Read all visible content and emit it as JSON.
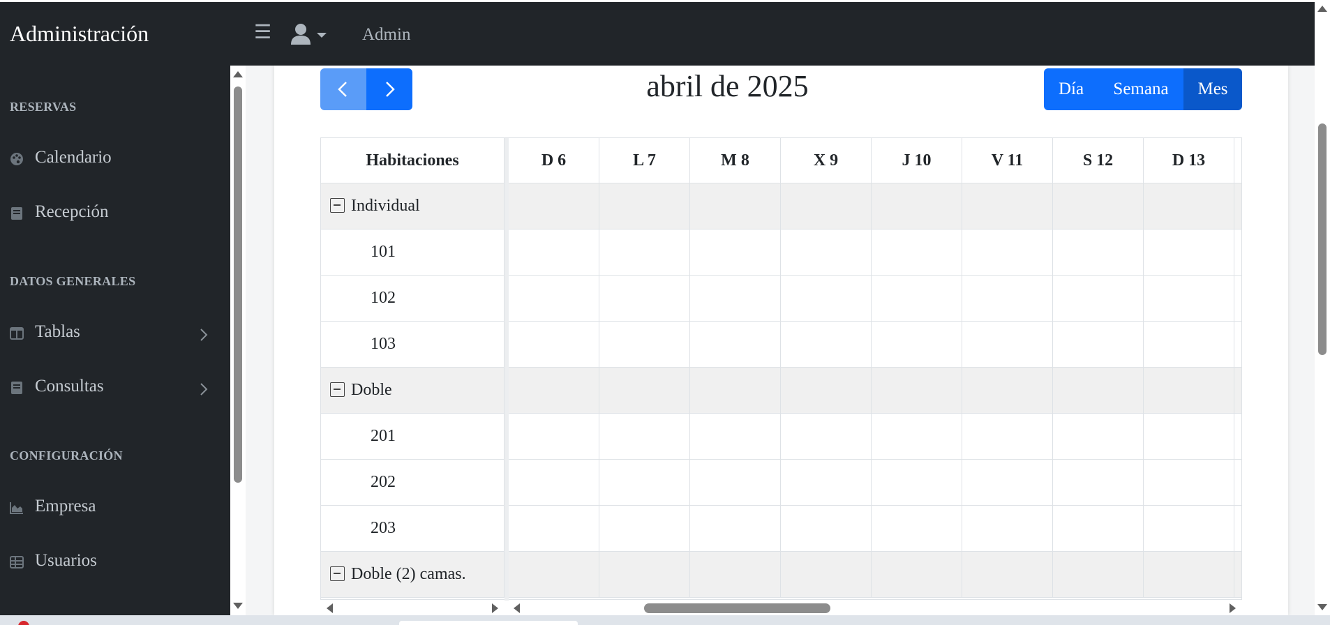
{
  "brand": "Administración",
  "header": {
    "user_name": "Admin"
  },
  "sidebar": {
    "sections": [
      {
        "heading": "RESERVAS",
        "items": [
          {
            "label": "Calendario",
            "icon": "palette-icon"
          },
          {
            "label": "Recepción",
            "icon": "book-icon"
          }
        ]
      },
      {
        "heading": "DATOS GENERALES",
        "items": [
          {
            "label": "Tablas",
            "icon": "columns-icon"
          },
          {
            "label": "Consultas",
            "icon": "book-icon"
          }
        ]
      },
      {
        "heading": "CONFIGURACIÓN",
        "items": [
          {
            "label": "Empresa",
            "icon": "area-chart-icon"
          },
          {
            "label": "Usuarios",
            "icon": "table-icon"
          }
        ]
      }
    ]
  },
  "calendar": {
    "title": "abril de 2025",
    "views": [
      {
        "label": "Día",
        "active": false
      },
      {
        "label": "Semana",
        "active": false
      },
      {
        "label": "Mes",
        "active": true
      }
    ],
    "resource_header": "Habitaciones",
    "days": [
      "D 6",
      "L 7",
      "M 8",
      "X 9",
      "J 10",
      "V 11",
      "S 12",
      "D 13"
    ],
    "rows": [
      {
        "type": "group",
        "label": "Individual"
      },
      {
        "type": "room",
        "label": "101"
      },
      {
        "type": "room",
        "label": "102"
      },
      {
        "type": "room",
        "label": "103"
      },
      {
        "type": "group",
        "label": "Doble"
      },
      {
        "type": "room",
        "label": "201"
      },
      {
        "type": "room",
        "label": "202"
      },
      {
        "type": "room",
        "label": "203"
      },
      {
        "type": "group",
        "label": "Doble (2) camas."
      }
    ]
  },
  "colors": {
    "primary": "#0d6efd",
    "primary_active": "#0a58ca",
    "sidebar_bg": "#212529"
  }
}
